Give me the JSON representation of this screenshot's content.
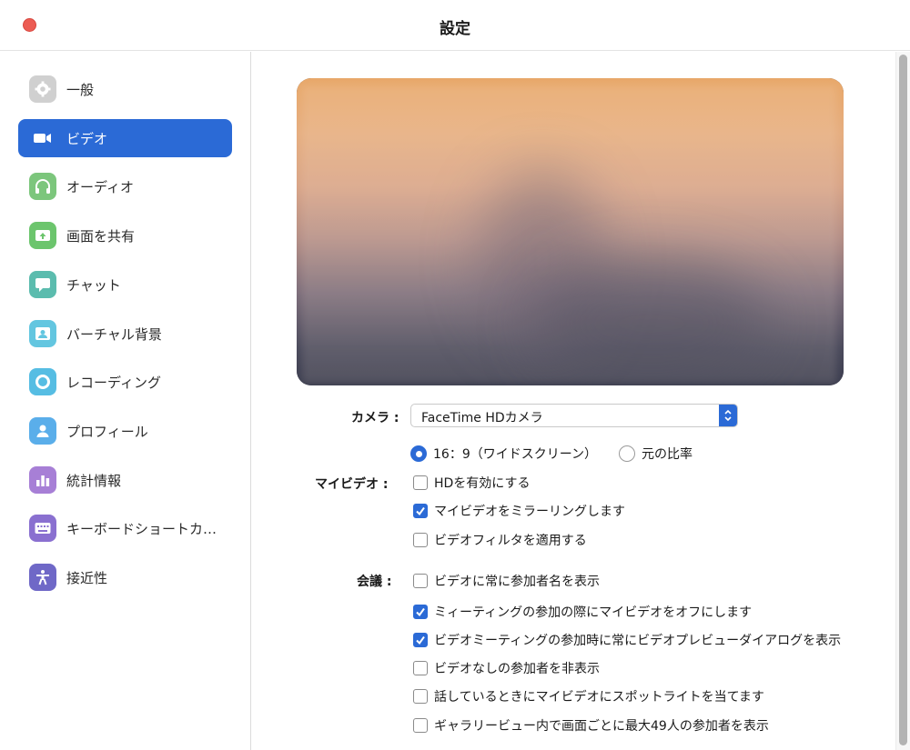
{
  "window": {
    "title": "設定"
  },
  "sidebar": {
    "items": [
      {
        "label": "一般",
        "icon": "gear-icon",
        "color": "#d0d0d0",
        "active": false
      },
      {
        "label": "ビデオ",
        "icon": "video-camera-icon",
        "color": "#2b6ad6",
        "active": true
      },
      {
        "label": "オーディオ",
        "icon": "headphones-icon",
        "color": "#7cc67c",
        "active": false
      },
      {
        "label": "画面を共有",
        "icon": "share-screen-icon",
        "color": "#6cc56d",
        "active": false
      },
      {
        "label": "チャット",
        "icon": "chat-bubble-icon",
        "color": "#5bbcae",
        "active": false
      },
      {
        "label": "バーチャル背景",
        "icon": "virtual-background-icon",
        "color": "#63c6e0",
        "active": false
      },
      {
        "label": "レコーディング",
        "icon": "record-icon",
        "color": "#56bde3",
        "active": false
      },
      {
        "label": "プロフィール",
        "icon": "profile-icon",
        "color": "#5aaeea",
        "active": false
      },
      {
        "label": "統計情報",
        "icon": "statistics-icon",
        "color": "#a77fd6",
        "active": false
      },
      {
        "label": "キーボードショートカ…",
        "icon": "keyboard-icon",
        "color": "#8a70d0",
        "active": false
      },
      {
        "label": "接近性",
        "icon": "accessibility-icon",
        "color": "#6f68c7",
        "active": false
      }
    ]
  },
  "camera": {
    "label": "カメラ :",
    "value": "FaceTime HDカメラ"
  },
  "my_video": {
    "label": "マイビデオ :",
    "ratio_options": [
      {
        "label": "16：9（ワイドスクリーン）",
        "checked": true
      },
      {
        "label": "元の比率",
        "checked": false
      }
    ],
    "checkboxes": [
      {
        "label": "HDを有効にする",
        "checked": false
      },
      {
        "label": "マイビデオをミラーリングします",
        "checked": true
      },
      {
        "label": "ビデオフィルタを適用する",
        "checked": false
      }
    ]
  },
  "meeting": {
    "label": "会議 :",
    "checkboxes": [
      {
        "label": "ビデオに常に参加者名を表示",
        "checked": false
      },
      {
        "label": "ミィーティングの参加の際にマイビデオをオフにします",
        "checked": true
      },
      {
        "label": "ビデオミーティングの参加時に常にビデオプレビューダイアログを表示",
        "checked": true
      },
      {
        "label": "ビデオなしの参加者を非表示",
        "checked": false
      },
      {
        "label": "話しているときにマイビデオにスポットライトを当てます",
        "checked": false
      },
      {
        "label": "ギャラリービュー内で画面ごとに最大49人の参加者を表示",
        "checked": false
      }
    ]
  },
  "colors": {
    "accent": "#2b6ad6",
    "close": "#ec5c53"
  }
}
